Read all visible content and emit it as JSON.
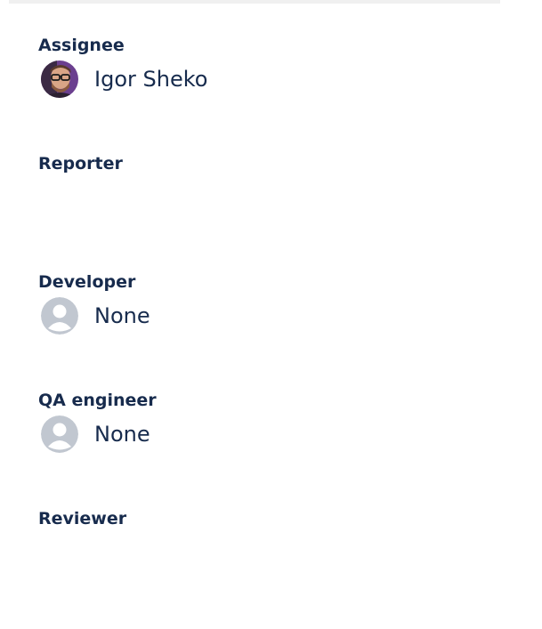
{
  "fields": {
    "assignee": {
      "label": "Assignee",
      "value": "Igor Sheko",
      "avatar_icon": "user-photo-avatar"
    },
    "reporter": {
      "label": "Reporter"
    },
    "developer": {
      "label": "Developer",
      "value": "None",
      "avatar_icon": "default-user-icon"
    },
    "qa_engineer": {
      "label": "QA engineer",
      "value": "None",
      "avatar_icon": "default-user-icon"
    },
    "reviewer": {
      "label": "Reviewer"
    }
  },
  "colors": {
    "text": "#172b4d",
    "placeholder_avatar": "#c1c7d0",
    "divider": "#f0f0f0"
  }
}
